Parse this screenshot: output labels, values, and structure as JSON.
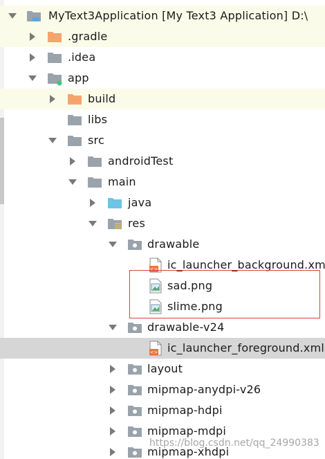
{
  "tree": {
    "root": {
      "name": "MyText3Application",
      "module": "[My Text3 Application]",
      "path": "D:\\"
    },
    "gradle": ".gradle",
    "idea": ".idea",
    "app": "app",
    "build": "build",
    "libs": "libs",
    "src": "src",
    "android_test": "androidTest",
    "main": "main",
    "java": "java",
    "res": "res",
    "drawable": "drawable",
    "ic_launcher_background": "ic_launcher_background.xm",
    "sad": "sad.png",
    "slime": "slime.png",
    "drawable_v24": "drawable-v24",
    "ic_launcher_foreground": "ic_launcher_foreground.xml",
    "layout": "layout",
    "mipmap_anydpi": "mipmap-anydpi-v26",
    "mipmap_hdpi": "mipmap-hdpi",
    "mipmap_mdpi": "mipmap-mdpi",
    "mipmap_xhdpi": "mipmap-xhdpi"
  },
  "watermark": "https://blog.csdn.net/qq_24990383",
  "colors": {
    "folder_orange": "#f5a56b",
    "folder_gray": "#9aa3ab",
    "folder_blue": "#6fc3e6",
    "highlight_bg": "#fbfbe9",
    "selected_bg": "#d6d6d6",
    "annotation_red": "#d9433b"
  }
}
